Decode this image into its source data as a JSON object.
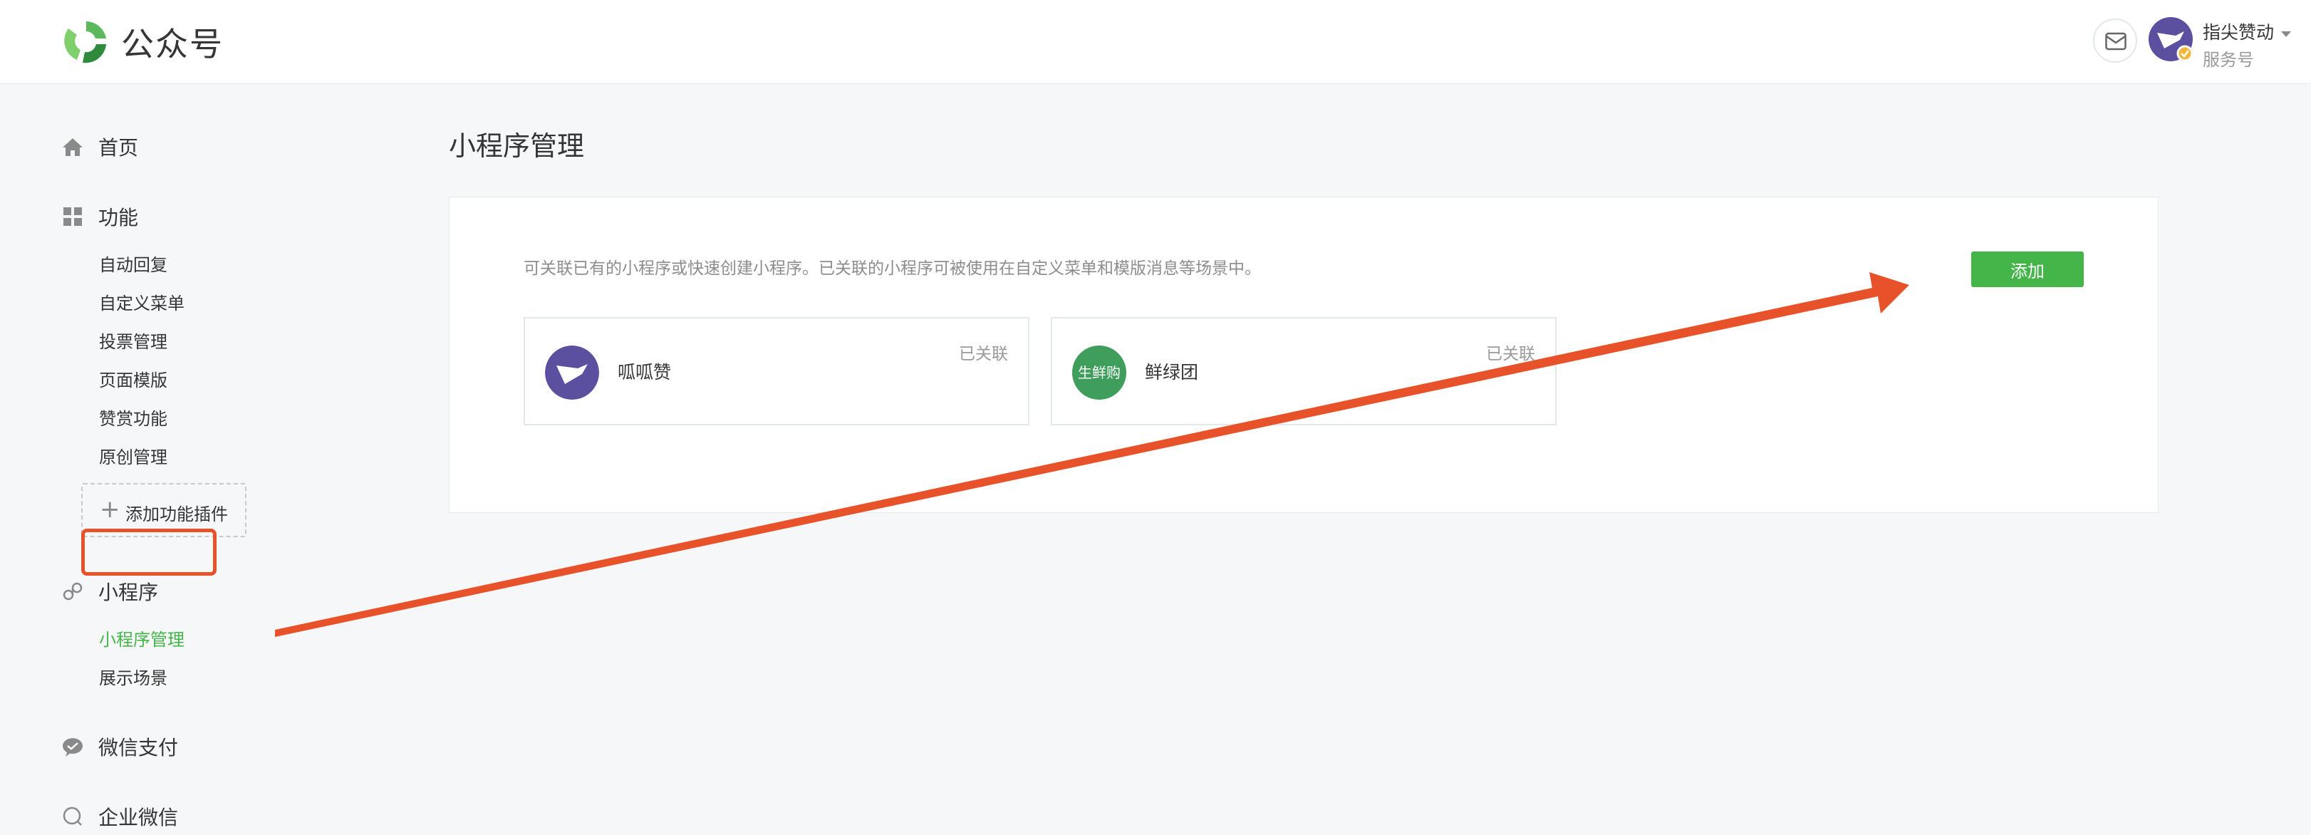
{
  "header": {
    "brand": "公众号",
    "account_name": "指尖赞动",
    "account_type": "服务号"
  },
  "sidebar": {
    "sections": [
      {
        "label": "首页",
        "icon": "home-icon"
      },
      {
        "label": "功能",
        "icon": "grid-icon"
      },
      {
        "label": "小程序",
        "icon": "link-icon"
      },
      {
        "label": "微信支付",
        "icon": "wechat-pay-icon"
      },
      {
        "label": "企业微信",
        "icon": "wework-icon"
      }
    ],
    "features": [
      "自动回复",
      "自定义菜单",
      "投票管理",
      "页面模版",
      "赞赏功能",
      "原创管理"
    ],
    "add_plugin": "添加功能插件",
    "miniprogram": [
      "小程序管理",
      "展示场景"
    ]
  },
  "main": {
    "title": "小程序管理",
    "description": "可关联已有的小程序或快速创建小程序。已关联的小程序可被使用在自定义菜单和模版消息等场景中。",
    "add_button": "添加",
    "cards": [
      {
        "name": "呱呱赞",
        "status": "已关联"
      },
      {
        "name": "鲜绿团",
        "status": "已关联",
        "avatar_text": "生鲜购"
      }
    ]
  },
  "colors": {
    "accent_green": "#44b549",
    "annotation_red": "#e8522a"
  }
}
